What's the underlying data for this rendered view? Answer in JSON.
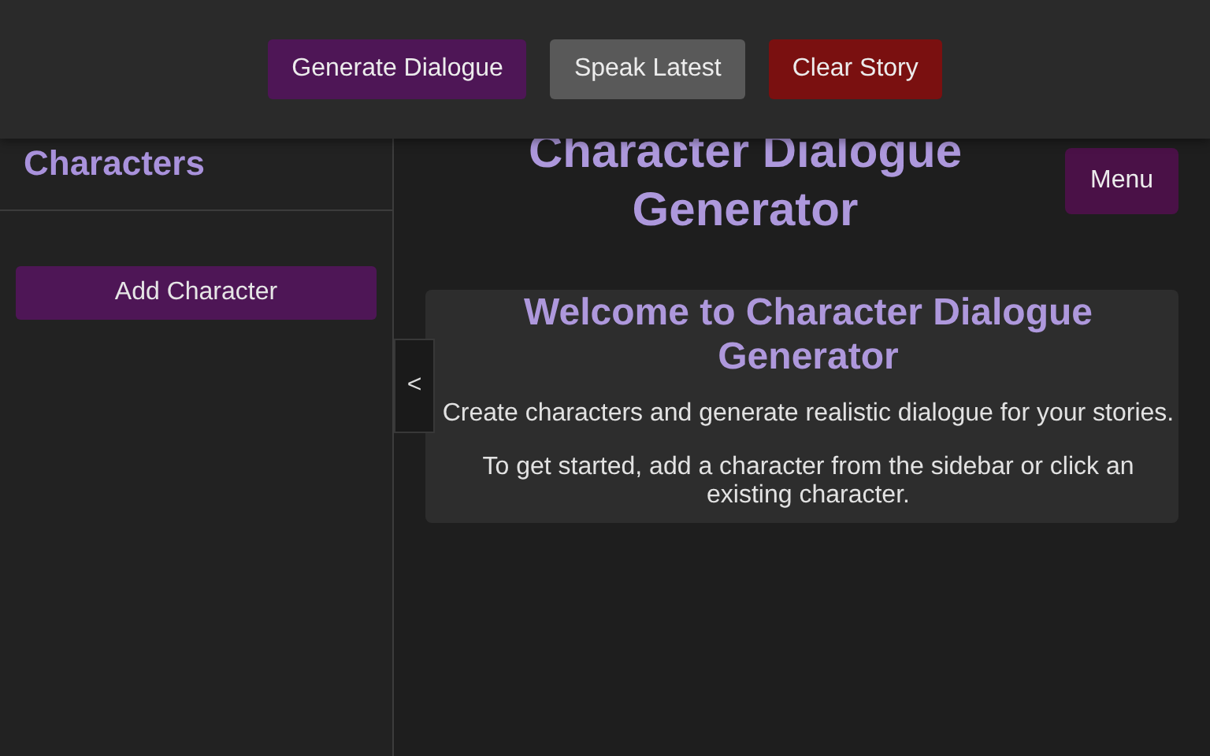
{
  "toolbar": {
    "buttons": [
      {
        "label": "Generate Dialogue",
        "kind": "primary"
      },
      {
        "label": "Speak Latest",
        "kind": "neutral"
      },
      {
        "label": "Clear Story",
        "kind": "danger"
      }
    ]
  },
  "sidebar": {
    "title": "Characters",
    "add_button": "Add Character",
    "toggle": "<"
  },
  "header": {
    "title": "Character Dialogue Generator",
    "menu_button": "Menu"
  },
  "welcome": {
    "title": "Welcome to Character Dialogue Generator",
    "paragraphs": [
      "Create characters and generate realistic dialogue for your stories.",
      "To get started, add a character from the sidebar or click an existing character."
    ]
  }
}
